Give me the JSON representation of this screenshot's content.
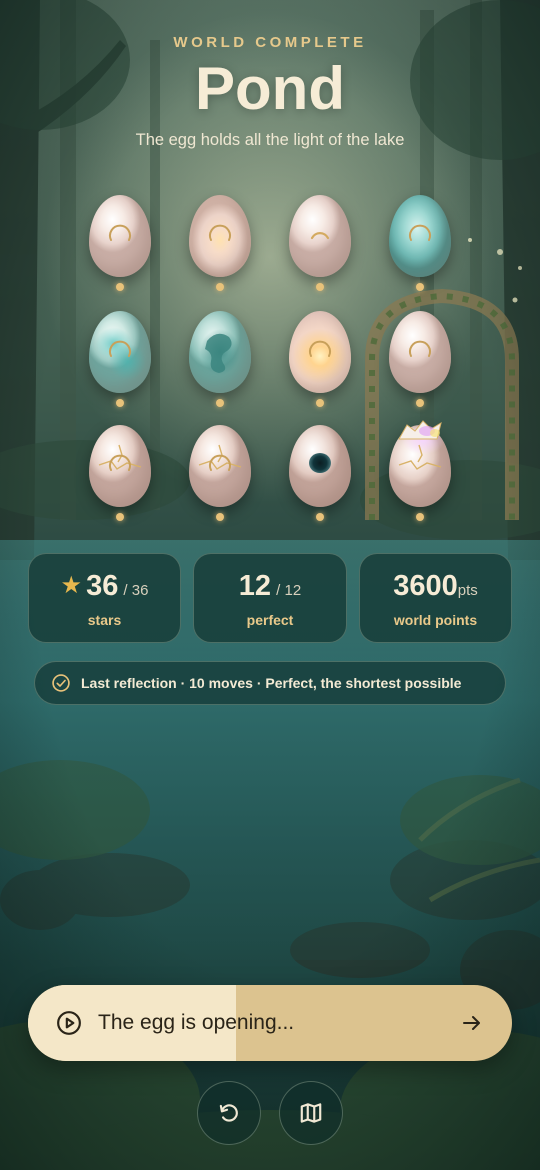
{
  "header": {
    "eyebrow": "WORLD COMPLETE",
    "title": "Pond",
    "subtitle": "The egg holds all the light of the lake"
  },
  "eggs": [
    {
      "style": "pearl",
      "mark": "ring",
      "progress_dot": true
    },
    {
      "style": "warm",
      "mark": "ring",
      "progress_dot": true
    },
    {
      "style": "pearl",
      "mark": "crescent",
      "progress_dot": true
    },
    {
      "style": "teal",
      "mark": "ring",
      "progress_dot": true
    },
    {
      "style": "teal-mix",
      "mark": "ring",
      "progress_dot": true
    },
    {
      "style": "dragon",
      "mark": "none",
      "progress_dot": true
    },
    {
      "style": "glow",
      "mark": "ring",
      "progress_dot": true
    },
    {
      "style": "pearl",
      "mark": "ring",
      "progress_dot": true
    },
    {
      "style": "cracked",
      "mark": "ring",
      "progress_dot": true
    },
    {
      "style": "cracked",
      "mark": "ring",
      "progress_dot": true
    },
    {
      "style": "hole",
      "mark": "none",
      "progress_dot": true
    },
    {
      "style": "opening",
      "mark": "none",
      "progress_dot": true
    }
  ],
  "stats": {
    "stars": {
      "value": "36",
      "total": "/ 36",
      "label": "stars",
      "icon": "star-icon"
    },
    "perfect": {
      "value": "12",
      "total": "/ 12",
      "label": "perfect"
    },
    "points": {
      "value": "3600",
      "unit": "pts",
      "label": "world points"
    }
  },
  "last_reflection": {
    "icon": "check-circle-icon",
    "text": "Last reflection · 10 moves · Perfect, the shortest possible"
  },
  "action": {
    "label": "The egg is opening...",
    "progress": 0.43,
    "play_icon": "play-circle-icon",
    "arrow_icon": "arrow-right-icon"
  },
  "buttons": {
    "replay_icon": "replay-icon",
    "map_icon": "map-icon"
  },
  "colors": {
    "accent_gold": "#e8c27a",
    "bar_fill": "#f4e7c8",
    "bar_track": "#dcc38f",
    "card_bg": "#123430"
  }
}
